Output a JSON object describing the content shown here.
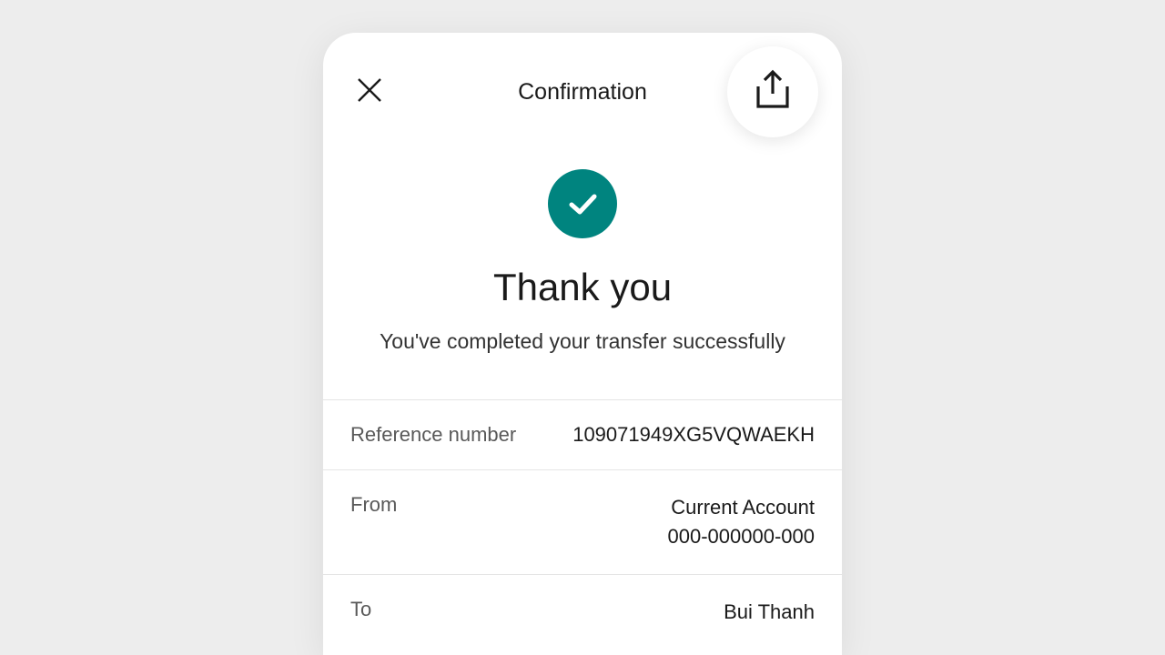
{
  "header": {
    "title": "Confirmation"
  },
  "success": {
    "title": "Thank you",
    "subtitle": "You've completed your transfer successfully"
  },
  "details": {
    "reference": {
      "label": "Reference number",
      "value": "109071949XG5VQWAEKH"
    },
    "from": {
      "label": "From",
      "line1": "Current Account",
      "line2": "000-000000-000"
    },
    "to": {
      "label": "To",
      "line1": "Bui Thanh"
    }
  },
  "colors": {
    "accent": "#00847f"
  }
}
